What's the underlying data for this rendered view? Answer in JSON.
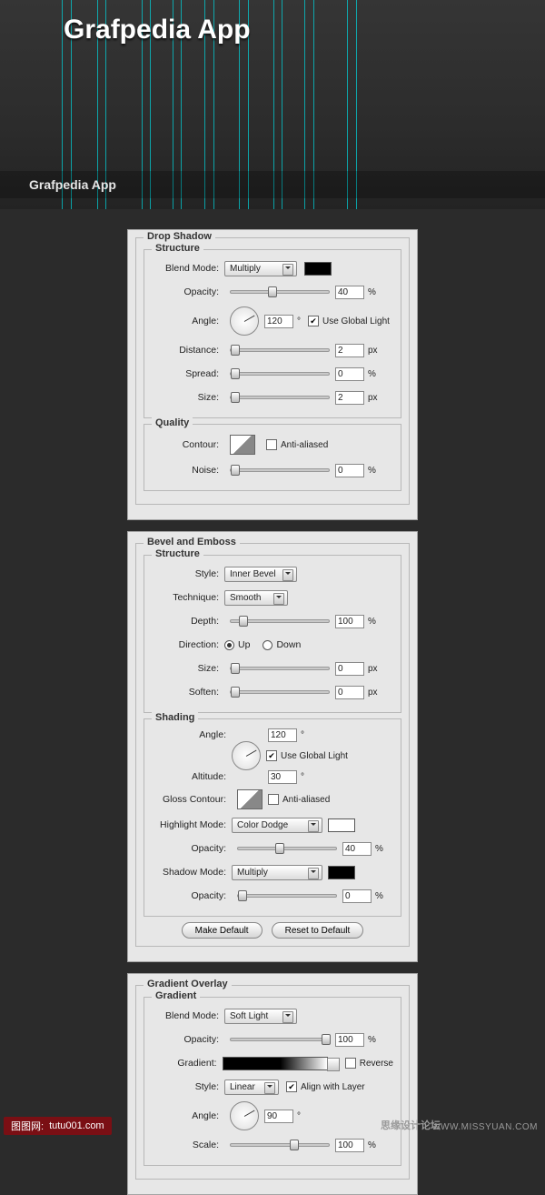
{
  "hero": {
    "title": "Grafpedia App",
    "subtitle": "Grafpedia App"
  },
  "guides_x": [
    68,
    78,
    107,
    116,
    156,
    165,
    190,
    199,
    225,
    235,
    263,
    273,
    301,
    310,
    335,
    345,
    382,
    392
  ],
  "drop_shadow": {
    "title": "Drop Shadow",
    "structure_title": "Structure",
    "blend_mode": {
      "label": "Blend Mode:",
      "value": "Multiply"
    },
    "opacity": {
      "label": "Opacity:",
      "value": "40",
      "unit": "%"
    },
    "angle": {
      "label": "Angle:",
      "value": "120",
      "unit": "°",
      "global": "Use Global Light"
    },
    "distance": {
      "label": "Distance:",
      "value": "2",
      "unit": "px"
    },
    "spread": {
      "label": "Spread:",
      "value": "0",
      "unit": "%"
    },
    "size": {
      "label": "Size:",
      "value": "2",
      "unit": "px"
    },
    "quality_title": "Quality",
    "contour": {
      "label": "Contour:",
      "anti": "Anti-aliased"
    },
    "noise": {
      "label": "Noise:",
      "value": "0",
      "unit": "%"
    }
  },
  "bevel": {
    "title": "Bevel and Emboss",
    "structure_title": "Structure",
    "style": {
      "label": "Style:",
      "value": "Inner Bevel"
    },
    "technique": {
      "label": "Technique:",
      "value": "Smooth"
    },
    "depth": {
      "label": "Depth:",
      "value": "100",
      "unit": "%"
    },
    "direction": {
      "label": "Direction:",
      "up": "Up",
      "down": "Down"
    },
    "size": {
      "label": "Size:",
      "value": "0",
      "unit": "px"
    },
    "soften": {
      "label": "Soften:",
      "value": "0",
      "unit": "px"
    },
    "shading_title": "Shading",
    "angle": {
      "label": "Angle:",
      "value": "120",
      "unit": "°",
      "global": "Use Global Light"
    },
    "altitude": {
      "label": "Altitude:",
      "value": "30",
      "unit": "°"
    },
    "gloss": {
      "label": "Gloss Contour:",
      "anti": "Anti-aliased"
    },
    "highlight": {
      "label": "Highlight Mode:",
      "value": "Color Dodge",
      "opacity_label": "Opacity:",
      "opacity": "40",
      "unit": "%"
    },
    "shadow": {
      "label": "Shadow Mode:",
      "value": "Multiply",
      "opacity_label": "Opacity:",
      "opacity": "0",
      "unit": "%"
    },
    "make_default": "Make Default",
    "reset_default": "Reset to Default"
  },
  "gradient": {
    "title": "Gradient Overlay",
    "section": "Gradient",
    "blend_mode": {
      "label": "Blend Mode:",
      "value": "Soft Light"
    },
    "opacity": {
      "label": "Opacity:",
      "value": "100",
      "unit": "%"
    },
    "grad": {
      "label": "Gradient:",
      "reverse": "Reverse"
    },
    "style": {
      "label": "Style:",
      "value": "Linear",
      "align": "Align with Layer"
    },
    "angle": {
      "label": "Angle:",
      "value": "90",
      "unit": "°"
    },
    "scale": {
      "label": "Scale:",
      "value": "100",
      "unit": "%"
    }
  },
  "footer": {
    "left_a": "图图网:",
    "left_b": "tutu001.com",
    "mid": "思缘设计论坛",
    "right": "WWW.MISSYUAN.COM"
  }
}
